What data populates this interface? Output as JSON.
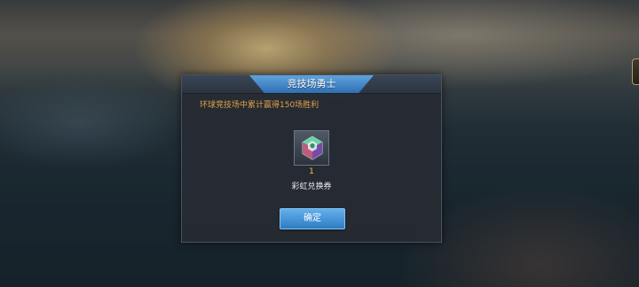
{
  "dialog": {
    "title": "竞技场勇士",
    "description": "环球竞技场中累计赢得150场胜利",
    "reward": {
      "count": "1",
      "name": "彩虹兑换券",
      "icon": "rainbow-voucher-icon"
    },
    "confirm_label": "确定"
  },
  "colors": {
    "title_plate": "#3f86c9",
    "description_text": "#e0a24a",
    "count_text": "#f1c24a",
    "button": "#3f8fd6"
  }
}
